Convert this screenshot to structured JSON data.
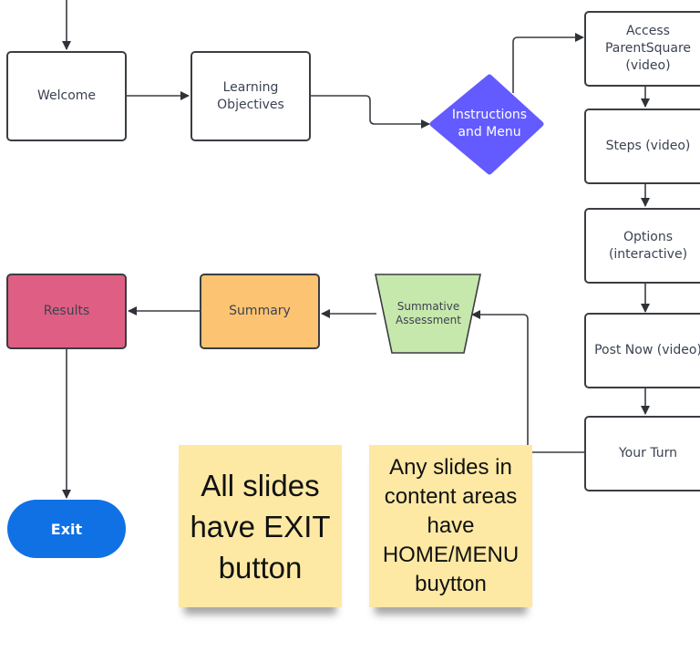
{
  "diagram": {
    "nodes": {
      "welcome": {
        "label": "Welcome",
        "shape": "rectangle"
      },
      "learning_objectives": {
        "label": "Learning\nObjectives",
        "shape": "rectangle"
      },
      "instructions_menu": {
        "label": "Instructions\nand Menu",
        "shape": "decision",
        "color": "#635bff"
      },
      "access_parentsquare": {
        "label": "Access\nParentSquare\n(video)",
        "shape": "rectangle"
      },
      "steps": {
        "label": "Steps (video)",
        "shape": "rectangle"
      },
      "options": {
        "label": "Options\n(interactive)",
        "shape": "rectangle"
      },
      "post_now": {
        "label": "Post Now (video)",
        "shape": "rectangle"
      },
      "your_turn": {
        "label": "Your Turn",
        "shape": "rectangle"
      },
      "summative_assessment": {
        "label": "Summative\nAssessment",
        "shape": "manual-operation",
        "color": "#c7e8ac"
      },
      "summary": {
        "label": "Summary",
        "shape": "rectangle",
        "color": "#fcc372"
      },
      "results": {
        "label": "Results",
        "shape": "rectangle",
        "color": "#de5f83"
      },
      "exit": {
        "label": "Exit",
        "shape": "terminator",
        "color": "#1071e5"
      }
    },
    "edges": [
      [
        "start",
        "welcome"
      ],
      [
        "welcome",
        "learning_objectives"
      ],
      [
        "learning_objectives",
        "instructions_menu"
      ],
      [
        "instructions_menu",
        "access_parentsquare"
      ],
      [
        "access_parentsquare",
        "steps"
      ],
      [
        "steps",
        "options"
      ],
      [
        "options",
        "post_now"
      ],
      [
        "post_now",
        "your_turn"
      ],
      [
        "your_turn",
        "summative_assessment"
      ],
      [
        "summative_assessment",
        "summary"
      ],
      [
        "summary",
        "results"
      ],
      [
        "results",
        "exit"
      ]
    ],
    "notes": [
      {
        "text": "All slides\nhave EXIT\nbutton",
        "color": "#fde9a4"
      },
      {
        "text": "Any slides in\ncontent areas\nhave\nHOME/MENU\nbuytton",
        "color": "#fde9a4"
      }
    ]
  }
}
